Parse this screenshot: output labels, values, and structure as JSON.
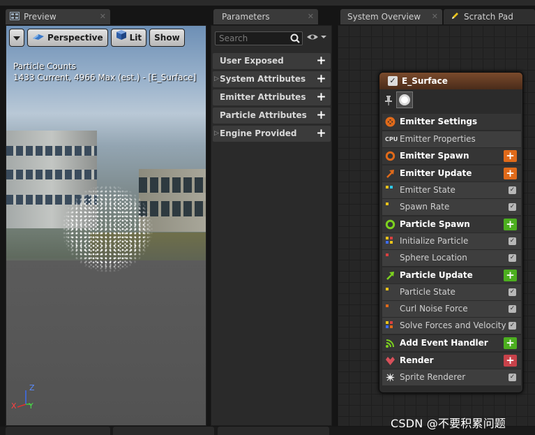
{
  "tabs": {
    "preview": {
      "label": "Preview"
    },
    "parameters": {
      "label": "Parameters"
    },
    "system_overview": {
      "label": "System Overview"
    },
    "scratch_pad": {
      "label": "Scratch Pad"
    }
  },
  "viewport_toolbar": {
    "perspective": "Perspective",
    "lit": "Lit",
    "show": "Show"
  },
  "particle_counts": {
    "title": "Particle Counts",
    "detail": "1433 Current, 4966 Max (est.) - [E_Surface]"
  },
  "axis": {
    "x": "X",
    "y": "Y",
    "z": "Z"
  },
  "parameters": {
    "search_placeholder": "Search",
    "categories": [
      {
        "label": "User Exposed",
        "expandable": false
      },
      {
        "label": "System Attributes",
        "expandable": true
      },
      {
        "label": "Emitter Attributes",
        "expandable": false
      },
      {
        "label": "Particle Attributes",
        "expandable": false
      },
      {
        "label": "Engine Provided",
        "expandable": true
      }
    ]
  },
  "emitter_node": {
    "title": "E_Surface",
    "enabled": true,
    "rows": [
      {
        "label": "Emitter Settings",
        "kind": "stage",
        "icon": "settings-icon"
      },
      {
        "label": "Emitter Properties",
        "kind": "module",
        "icon": "cpu-icon"
      },
      {
        "label": "Emitter Spawn",
        "kind": "stage",
        "icon": "ring-icon",
        "add_color": "#e06a1a"
      },
      {
        "label": "Emitter Update",
        "kind": "stage",
        "icon": "arrow-icon",
        "add_color": "#e06a1a"
      },
      {
        "label": "Emitter State",
        "kind": "module",
        "enabled": true
      },
      {
        "label": "Spawn Rate",
        "kind": "module",
        "enabled": true
      },
      {
        "label": "Particle Spawn",
        "kind": "stage",
        "icon": "ring-icon",
        "add_color": "#4caf1f"
      },
      {
        "label": "Initialize Particle",
        "kind": "module",
        "enabled": true
      },
      {
        "label": "Sphere Location",
        "kind": "module",
        "enabled": true
      },
      {
        "label": "Particle Update",
        "kind": "stage",
        "icon": "arrow-icon",
        "add_color": "#4caf1f"
      },
      {
        "label": "Particle State",
        "kind": "module",
        "enabled": true
      },
      {
        "label": "Curl Noise Force",
        "kind": "module",
        "enabled": true
      },
      {
        "label": "Solve Forces and Velocity",
        "kind": "module",
        "enabled": true
      },
      {
        "label": "Add Event Handler",
        "kind": "stage",
        "icon": "event-icon",
        "add_color": "#4caf1f"
      },
      {
        "label": "Render",
        "kind": "stage",
        "icon": "render-icon",
        "add_color": "#c8424a"
      },
      {
        "label": "Sprite Renderer",
        "kind": "module",
        "icon": "sprite-icon",
        "enabled": true
      }
    ]
  },
  "colors": {
    "emitter_orange": "#e06a1a",
    "particle_green": "#7cd11f",
    "render_red": "#c8424a"
  },
  "watermark": "CSDN @不要积累问题"
}
